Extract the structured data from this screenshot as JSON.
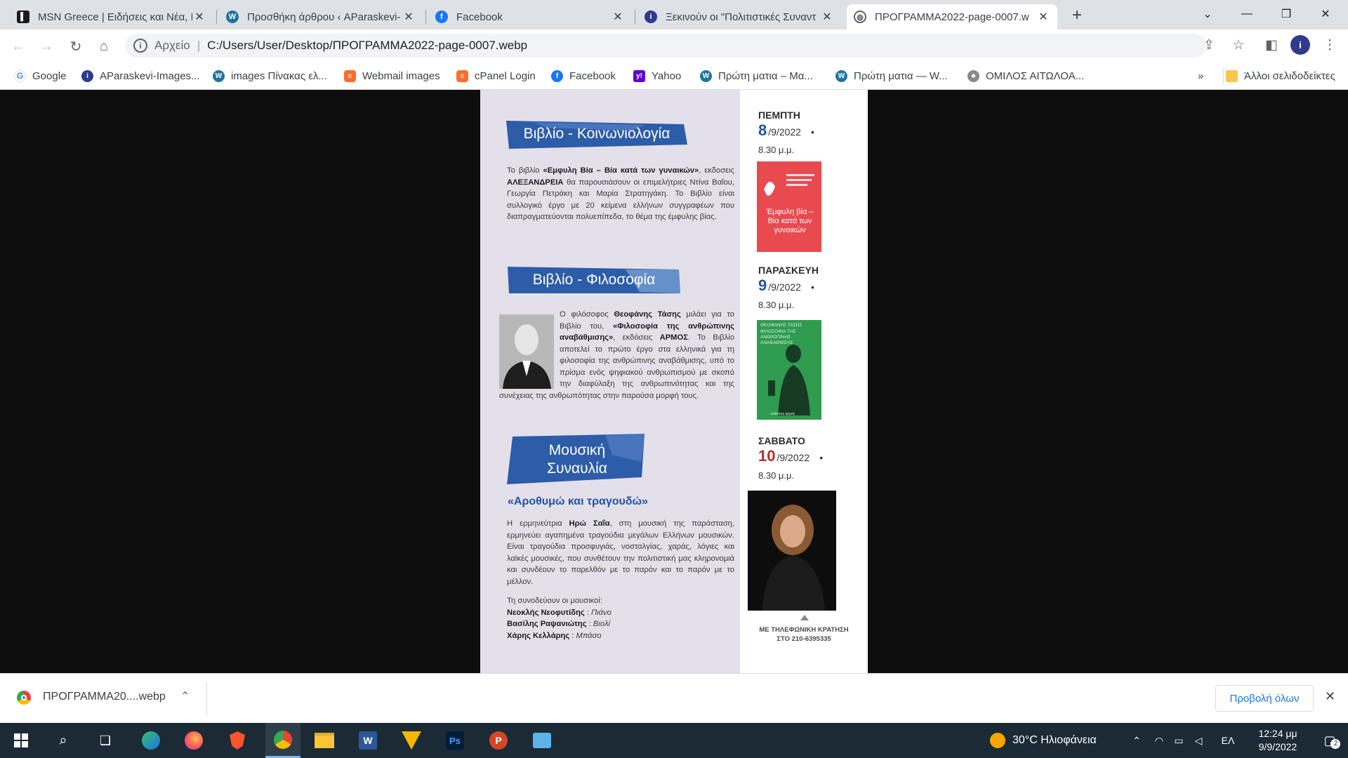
{
  "tabs": [
    {
      "title": "MSN Greece | Ειδήσεις και Νέα, Ε",
      "icon": "msn-icon",
      "color": "#1a1a1a"
    },
    {
      "title": "Προσθήκη άρθρου ‹ AParaskevi-",
      "icon": "wordpress-icon",
      "color": "#21759b"
    },
    {
      "title": "Facebook",
      "icon": "facebook-icon",
      "color": "#1877f2"
    },
    {
      "title": "Ξεκινούν οι \"Πολιτιστικές Συναντ",
      "icon": "aparaskevi-icon",
      "color": "#2e3a8c"
    },
    {
      "title": "ΠΡΟΓΡΑΜΜΑ2022-page-0007.w",
      "icon": "globe-icon",
      "color": "#5f6368"
    }
  ],
  "toolbar": {
    "scheme": "Αρχείο",
    "url": "C:/Users/User/Desktop/ΠΡΟΓΡΑΜΜΑ2022-page-0007.webp"
  },
  "bookmarks": [
    {
      "label": "Google",
      "icon": "google-icon"
    },
    {
      "label": "AParaskevi-Images...",
      "icon": "aparaskevi-icon"
    },
    {
      "label": "images Πίνακας ελ...",
      "icon": "wordpress-icon"
    },
    {
      "label": "Webmail images",
      "icon": "cpanel-icon"
    },
    {
      "label": "cPanel Login",
      "icon": "cpanel-icon"
    },
    {
      "label": "Facebook",
      "icon": "facebook-icon"
    },
    {
      "label": "Yahoo",
      "icon": "yahoo-icon"
    },
    {
      "label": "Πρώτη ματια – Μα...",
      "icon": "wordpress-icon"
    },
    {
      "label": "Πρώτη ματια — W...",
      "icon": "wordpress-icon"
    },
    {
      "label": "ΟΜΙΛΟΣ ΑΙΤΩΛΟΑ...",
      "icon": "club-icon"
    }
  ],
  "bookmarks_overflow": "»",
  "other_bookmarks": "Άλλοι σελιδοδείκτες",
  "document": {
    "banner1": "Βιβλίο - Κοινωνιολογία",
    "para1_pre": "Το βιβλίο ",
    "para1_bold": "«Εμφυλη Βία – Βία κατά των γυναικών»",
    "para1_mid": ", εκδοσεις ",
    "para1_bold2": "ΑΛΕΞΑΝΔΡΕΙΑ",
    "para1_post": " θα παρουσιάσουν οι επιμελήτριες Ντίνα Βαΐου, Γεωργία Πετράκη και Μαρία Στρατηγάκη. Το Βιβλίο είναι συλλογικό έργο με 20 κείμενα ελλήνων συγγραφέων που διαπραγματεύονται πολυεπίπεδα, το θέμα της έμφυλης βίας.",
    "banner2": "Βιβλίο - Φιλοσοφία",
    "para2_pre": "Ο φιλόσοφος ",
    "para2_bold": "Θεοφάνης Τάσης",
    "para2_mid": " μιλάει για το Βιβλίο του, ",
    "para2_bold2": "«Φιλοσοφία της ανθρώπινης αναβάθμισης»",
    "para2_mid2": ", εκδόσεις ",
    "para2_bold3": "ΑΡΜΟΣ",
    "para2_post": ". Το Βιβλίο αποτελεί το πρώτο έργο στα ελληνικά για τη φιλοσοφία της ανθρώπινης αναβάθμισης, υπό το πρίσμα ενός ψηφιακού ανθρωπισμού με σκοπό την διαφύλαξη της ανθρωπινότητας και της συνέχειας της ανθρωπότητας στην παρούσα μορφή τους.",
    "banner3_line1": "Μουσική",
    "banner3_line2": "Συναυλία",
    "subtitle": "«Αροθυμώ και τραγουδώ»",
    "para3_pre": "Η ερμηνεύτρια ",
    "para3_bold": "Ηρώ Σαΐα",
    "para3_post": ", στη μουσική της παράσταση, ερμηνεύει αγαπημένα τραγούδια μεγάλων Ελλήνων μουσικών. Είναι τραγούδια προσφυγιάς, νοσταλγίας, χαράς, λόγιες και λαϊκές μουσικές, που συνθέτουν την πολιτιστική μας κληρονομιά και συνδέουν το παρελθόν με το παρόν και το παρόν με το μέλλον.",
    "accomp_intro": "Τη συνοδεύουν οι μουσικοί:",
    "musicians": [
      {
        "name": "Νεοκλής Νεοφυτίδης",
        "instrument": "Πιάνο"
      },
      {
        "name": "Βασίλης Ραψανιώτης",
        "instrument": "Βιολί"
      },
      {
        "name": "Χάρης Κελλάρης",
        "instrument": "Μπάσο"
      }
    ],
    "events": [
      {
        "day": "ΠΕΜΠΤΗ",
        "num": "8",
        "rest": "/9/2022",
        "time": "8.30 μ.μ."
      },
      {
        "day": "ΠΑΡΑΣΚΕΥΗ",
        "num": "9",
        "rest": "/9/2022",
        "time": "8.30 μ.μ."
      },
      {
        "day": "ΣΑΒΒΑΤΟ",
        "num": "10",
        "rest": "/9/2022",
        "time": "8.30 μ.μ."
      }
    ],
    "bullet": "•",
    "book1_title": "Έμφυλη βία – Βία κατά των γυναικών",
    "book2_author": "ΘΕΟΦΑΝΗΣ ΤΑΣΗΣ",
    "book2_title": "ΦΙΛΟΣΟΦΙΑ ΤΗΣ ΑΝΘΡΩΠΙΝΗΣ ΑΝΑΒΑΘΜΙΣΗΣ",
    "book2_publisher": "εκδόσεις αρμός",
    "reservation_line1": "ΜΕ ΤΗΛΕΦΩΝΙΚΗ ΚΡΑΤΗΣΗ",
    "reservation_line2": "ΣΤΟ 210-6395335"
  },
  "download": {
    "filename": "ΠΡΟΓΡΑΜΜΑ20....webp",
    "show_all": "Προβολή όλων"
  },
  "taskbar": {
    "weather": "30°C Ηλιοφάνεια",
    "lang": "ΕΛ",
    "time": "12:24 μμ",
    "date": "9/9/2022",
    "notifications": "2"
  },
  "colors": {
    "accent": "#1a73e8",
    "banner_blue": "#2d5ca8",
    "date_blue": "#2253a3",
    "date_red": "#b0302a",
    "book1": "#e84a4f",
    "book2": "#2e9b4f"
  }
}
